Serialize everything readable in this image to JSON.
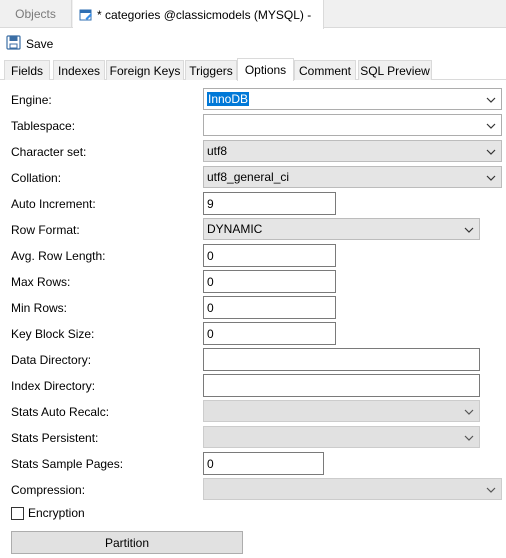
{
  "doc_tabs": {
    "objects_label": "Objects",
    "active_label": "* categories @classicmodels (MYSQL) -"
  },
  "toolbar": {
    "save_label": "Save"
  },
  "prop_tabs": [
    "Fields",
    "Indexes",
    "Foreign Keys",
    "Triggers",
    "Options",
    "Comment",
    "SQL Preview"
  ],
  "active_tab": "Options",
  "form": {
    "engine": {
      "label": "Engine:",
      "value": "InnoDB"
    },
    "tablespace": {
      "label": "Tablespace:",
      "value": ""
    },
    "charset": {
      "label": "Character set:",
      "value": "utf8"
    },
    "collation": {
      "label": "Collation:",
      "value": "utf8_general_ci"
    },
    "auto_increment": {
      "label": "Auto Increment:",
      "value": "9"
    },
    "row_format": {
      "label": "Row Format:",
      "value": "DYNAMIC"
    },
    "avg_row_length": {
      "label": "Avg. Row Length:",
      "value": "0"
    },
    "max_rows": {
      "label": "Max Rows:",
      "value": "0"
    },
    "min_rows": {
      "label": "Min Rows:",
      "value": "0"
    },
    "key_block_size": {
      "label": "Key Block Size:",
      "value": "0"
    },
    "data_directory": {
      "label": "Data Directory:",
      "value": ""
    },
    "index_directory": {
      "label": "Index Directory:",
      "value": ""
    },
    "stats_auto_recalc": {
      "label": "Stats Auto Recalc:",
      "value": ""
    },
    "stats_persistent": {
      "label": "Stats Persistent:",
      "value": ""
    },
    "stats_sample_pages": {
      "label": "Stats Sample Pages:",
      "value": "0"
    },
    "compression": {
      "label": "Compression:",
      "value": ""
    },
    "encryption": {
      "label": "Encryption",
      "checked": false
    }
  },
  "partition_label": "Partition",
  "colors": {
    "selection": "#0078d7",
    "tab_bg": "#f0f0f0",
    "border": "#dadada"
  },
  "icons": [
    "table-design-icon",
    "save-icon",
    "chevron-down-icon"
  ]
}
